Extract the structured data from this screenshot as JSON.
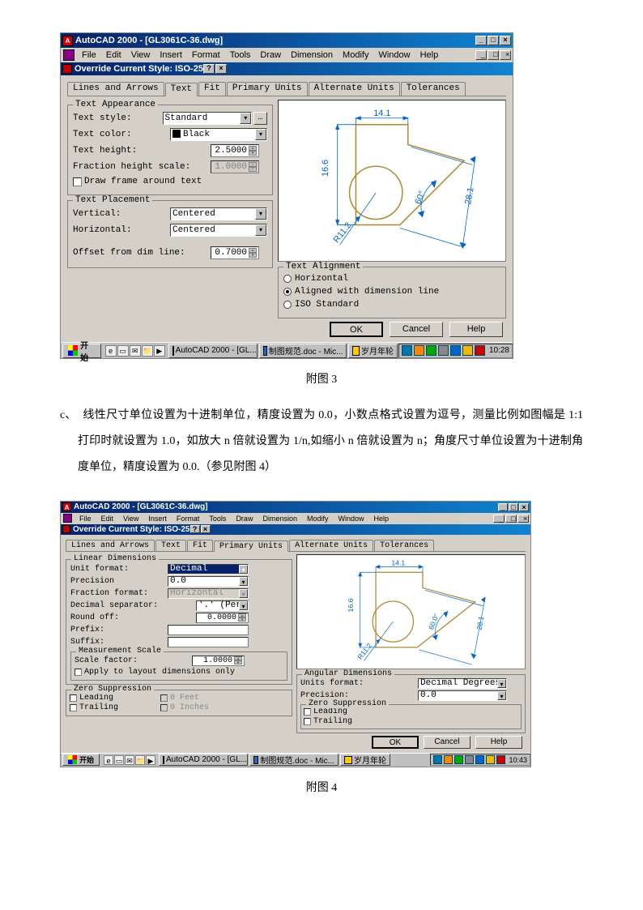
{
  "fig3": {
    "appTitle": "AutoCAD 2000 - [GL3061C-36.dwg]",
    "menus": [
      "File",
      "Edit",
      "View",
      "Insert",
      "Format",
      "Tools",
      "Draw",
      "Dimension",
      "Modify",
      "Window",
      "Help"
    ],
    "dialogTitle": "Override Current Style: ISO-25",
    "tabs": [
      "Lines and Arrows",
      "Text",
      "Fit",
      "Primary Units",
      "Alternate Units",
      "Tolerances"
    ],
    "activeTab": "Text",
    "textAppearance": {
      "title": "Text Appearance",
      "textStyleLabel": "Text style:",
      "textStyleValue": "Standard",
      "textColorLabel": "Text color:",
      "textColorValue": "Black",
      "textHeightLabel": "Text height:",
      "textHeightValue": "2.5000",
      "fractionHeightLabel": "Fraction height scale:",
      "fractionHeightValue": "1.0000",
      "drawFrameLabel": "Draw frame around text"
    },
    "textPlacement": {
      "title": "Text Placement",
      "verticalLabel": "Vertical:",
      "verticalValue": "Centered",
      "horizontalLabel": "Horizontal:",
      "horizontalValue": "Centered",
      "offsetLabel": "Offset from dim line:",
      "offsetValue": "0.7000"
    },
    "textAlignment": {
      "title": "Text Alignment",
      "options": [
        "Horizontal",
        "Aligned with dimension line",
        "ISO Standard"
      ],
      "selected": "Aligned with dimension line"
    },
    "preview": {
      "d1": "14.1",
      "d2": "16.6",
      "d3": "28.1",
      "d4": "60°",
      "d5": "R11.2"
    },
    "buttons": {
      "ok": "OK",
      "cancel": "Cancel",
      "help": "Help"
    },
    "taskbar": {
      "start": "开始",
      "apps": [
        "AutoCAD 2000 - [GL...",
        "制图规范.doc - Mic...",
        "岁月年轮"
      ],
      "time": "10:28"
    },
    "caption": "附图 3"
  },
  "bodyText": {
    "bullet": "c、",
    "content": "线性尺寸单位设置为十进制单位，精度设置为 0.0，小数点格式设置为逗号，测量比例如图幅是 1:1 打印时就设置为 1.0，如放大 n 倍就设置为 1/n,如缩小 n 倍就设置为 n；角度尺寸单位设置为十进制角度单位，精度设置为 0.0.（参见附图 4）"
  },
  "fig4": {
    "appTitle": "AutoCAD 2000 - [GL3061C-36.dwg]",
    "dialogTitle": "Override Current Style: ISO-25",
    "tabs": [
      "Lines and Arrows",
      "Text",
      "Fit",
      "Primary Units",
      "Alternate Units",
      "Tolerances"
    ],
    "activeTab": "Primary Units",
    "linearDimensions": {
      "title": "Linear Dimensions",
      "unitFormatLabel": "Unit format:",
      "unitFormatValue": "Decimal",
      "precisionLabel": "Precision",
      "precisionValue": "0.0",
      "fractionFormatLabel": "Fraction format:",
      "fractionFormatValue": "Horizontal",
      "decimalSepLabel": "Decimal separator:",
      "decimalSepValue": "'.' (Perio",
      "roundOffLabel": "Round off:",
      "roundOffValue": "0.0000",
      "prefixLabel": "Prefix:",
      "suffixLabel": "Suffix:"
    },
    "measurementScale": {
      "title": "Measurement Scale",
      "scaleFactorLabel": "Scale factor:",
      "scaleFactorValue": "1.0000",
      "applyLayoutLabel": "Apply to layout dimensions only"
    },
    "zeroSuppression": {
      "title": "Zero Suppression",
      "leading": "Leading",
      "trailing": "Trailing",
      "feet": "0 Feet",
      "inches": "0 Inches"
    },
    "angularDimensions": {
      "title": "Angular Dimensions",
      "unitsFormatLabel": "Units format:",
      "unitsFormatValue": "Decimal Degrees",
      "precisionLabel": "Precision:",
      "precisionValue": "0.0",
      "zeroTitle": "Zero Suppression",
      "leading": "Leading",
      "trailing": "Trailing"
    },
    "preview": {
      "d1": "14.1",
      "d2": "16.6",
      "d3": "28.1",
      "d4": "60.0°",
      "d5": "R11.2"
    },
    "buttons": {
      "ok": "OK",
      "cancel": "Cancel",
      "help": "Help"
    },
    "taskbar": {
      "start": "开始",
      "apps": [
        "AutoCAD 2000 - [GL...",
        "制图规范.doc - Mic...",
        "岁月年轮"
      ],
      "time": "10:43"
    },
    "caption": "附图 4"
  }
}
